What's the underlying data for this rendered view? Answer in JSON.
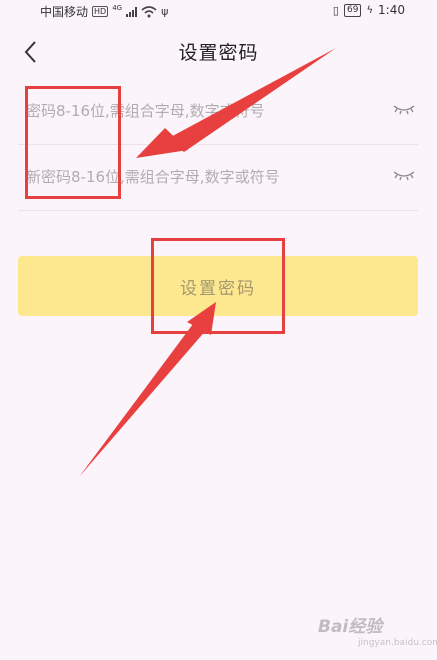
{
  "status_bar": {
    "carrier": "中国移动",
    "hd_badge": "HD",
    "network": "4G",
    "battery": "69",
    "time": "1:40",
    "icons": [
      "signal-icon",
      "wifi-icon",
      "usb-icon",
      "vibrate-icon",
      "battery-icon",
      "charging-icon"
    ]
  },
  "header": {
    "title": "设置密码",
    "back_icon": "chevron-left-icon"
  },
  "form": {
    "password_placeholder": "密码8-16位,需组合字母,数字或符号",
    "new_password_placeholder": "新密码8-16位,需组合字母,数字或符号",
    "visibility_icon": "eye-closed-icon"
  },
  "submit_button": {
    "label": "设置密码",
    "color": "#fde78f"
  },
  "annotations": {
    "color": "#e8403f"
  },
  "watermark": {
    "text": "Bai经验",
    "sub": "jingyan.baidu.com"
  }
}
